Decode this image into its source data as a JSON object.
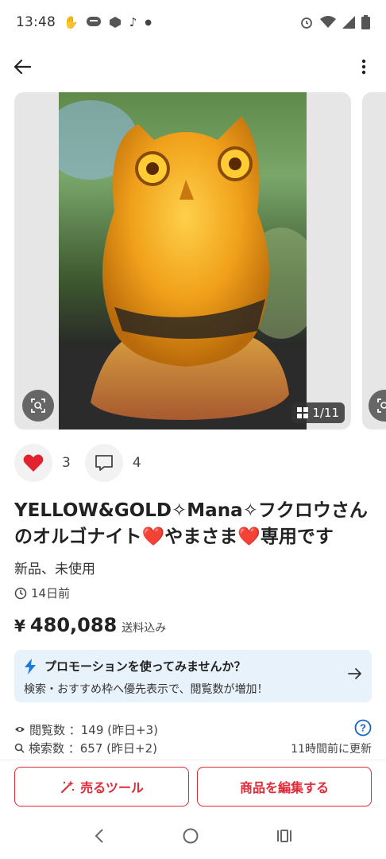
{
  "status_bar": {
    "time": "13:48",
    "left_icons": [
      "hand-icon",
      "line-icon",
      "app-icon",
      "tiktok-icon",
      "dot-icon"
    ],
    "right_icons": [
      "alarm-icon",
      "wifi-icon",
      "signal-icon",
      "battery-icon"
    ]
  },
  "header": {
    "back_icon": "arrow-left-icon",
    "menu_icon": "more-vertical-icon"
  },
  "gallery": {
    "counter": "1/11",
    "current_page": 1,
    "total_pages": 11
  },
  "social": {
    "likes": "3",
    "comments": "4"
  },
  "product": {
    "title_part1": "YELLOW&GOLD✧Mana✧フクロウさんのオルゴナイト",
    "heart1": "❤️",
    "title_part2": "やまさま",
    "heart2": "❤️",
    "title_part3": "専用です",
    "condition": "新品、未使用",
    "posted": "14日前",
    "currency": "¥",
    "price": "480,088",
    "shipping": "送料込み"
  },
  "promo": {
    "title": "プロモーションを使ってみませんか？",
    "subtitle": "検索・おすすめ枠へ優先表示で、閲覧数が増加！"
  },
  "stats": {
    "views": "閲覧数 ：149 (昨日+3)",
    "searches": "検索数 ：657 (昨日+2)",
    "updated": "11時間前に更新"
  },
  "actions": {
    "sell_tool": "売るツール",
    "edit": "商品を編集する"
  },
  "colors": {
    "accent": "#e02a37",
    "promo_bg": "#e8f2fb",
    "lightning": "#1a7ad9",
    "help": "#1565c0"
  }
}
